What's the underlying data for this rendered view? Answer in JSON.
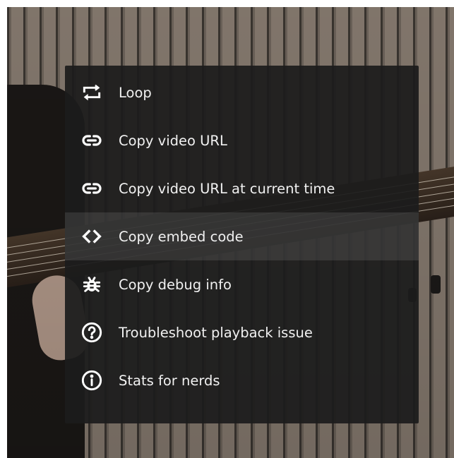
{
  "context_menu": {
    "items": [
      {
        "label": "Loop",
        "icon": "loop-icon"
      },
      {
        "label": "Copy video URL",
        "icon": "link-icon"
      },
      {
        "label": "Copy video URL at current time",
        "icon": "link-icon"
      },
      {
        "label": "Copy embed code",
        "icon": "code-icon"
      },
      {
        "label": "Copy debug info",
        "icon": "bug-icon"
      },
      {
        "label": "Troubleshoot playback issue",
        "icon": "help-circle-icon"
      },
      {
        "label": "Stats for nerds",
        "icon": "info-circle-icon"
      }
    ],
    "highlighted_item": "Copy embed code",
    "colors": {
      "menu_background": "#1c1c1c",
      "text": "#f1f1f1",
      "highlight": "#3a3a3a"
    }
  }
}
